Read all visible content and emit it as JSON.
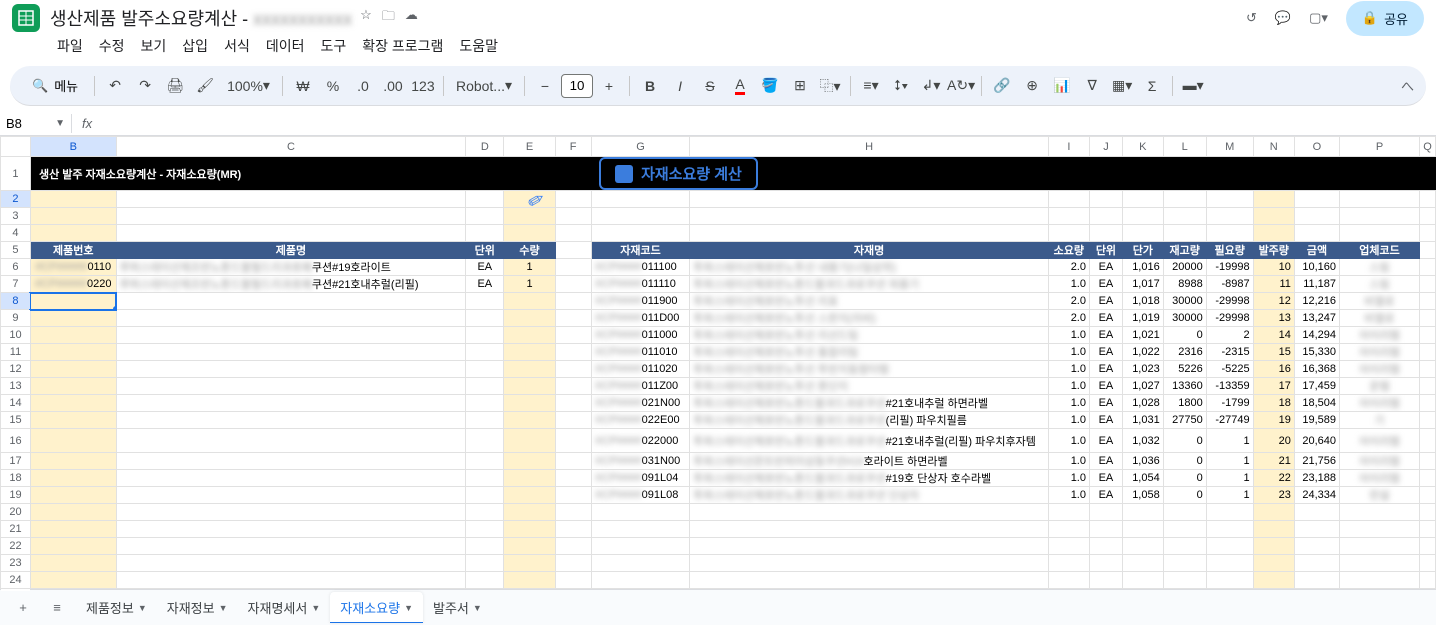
{
  "doc": {
    "title": "생산제품 발주소요량계산 - ",
    "title_suffix": "xxxxxxxxxxx"
  },
  "menus": [
    "파일",
    "수정",
    "보기",
    "삽입",
    "서식",
    "데이터",
    "도구",
    "확장 프로그램",
    "도움말"
  ],
  "toolbar": {
    "search_label": "메뉴",
    "zoom": "100%",
    "currency": "₩",
    "font": "Robot...",
    "font_size": "10"
  },
  "share_label": "공유",
  "namebox": "B8",
  "col_headers": [
    "",
    "B",
    "C",
    "D",
    "E",
    "F",
    "G",
    "H",
    "I",
    "J",
    "K",
    "L",
    "M",
    "N",
    "O",
    "P",
    "Q"
  ],
  "banner_title": "생산 발주 자재소요량계산 - 자재소요량(MR)",
  "calc_button": "자재소요량 계산",
  "left_headers": {
    "b": "제품번호",
    "c": "제품명",
    "d": "단위",
    "e": "수량"
  },
  "right_headers": {
    "g": "자재코드",
    "h": "자재명",
    "i": "소요량",
    "j": "단위",
    "k": "단가",
    "l": "재고량",
    "m": "필요량",
    "n": "발주량",
    "o": "금액",
    "p": "업체코드"
  },
  "left_rows": [
    {
      "b_pre": "#CP#####",
      "b_suf": "0110",
      "c_pre": "루퍼스테이선제조반노톤드팔필드리과호패",
      "c_suf": "쿠션#19호라이트",
      "d": "EA",
      "e": "1"
    },
    {
      "b_pre": "#CP#####",
      "b_suf": "0220",
      "c_pre": "루퍼스테이선제조반노톤드팔필드리과호패",
      "c_suf": "쿠션#21호내추럴(리필)",
      "d": "EA",
      "e": "1"
    }
  ],
  "right_rows": [
    {
      "g_pre": "XCP####",
      "g_suf": "011100",
      "h_pre": "투파스테이선체호반노투선 내용기(나일상위)",
      "h_suf": "",
      "i": "2.0",
      "j": "EA",
      "k": "1,016",
      "l": "20000",
      "m": "-19998",
      "n": "10",
      "o": "10,160",
      "p_pre": "스림",
      "p_suf": ""
    },
    {
      "g_pre": "XCP####",
      "g_suf": "011110",
      "h_pre": "투파스테이선체호반노톤드팔과드과로쿠션 외용기",
      "h_suf": "",
      "i": "1.0",
      "j": "EA",
      "k": "1,017",
      "l": "8988",
      "m": "-8987",
      "n": "11",
      "o": "11,187",
      "p_pre": "스림",
      "p_suf": ""
    },
    {
      "g_pre": "XCP####",
      "g_suf": "011900",
      "h_pre": "투파스테이선체호반노투선 리표",
      "h_suf": "",
      "i": "2.0",
      "j": "EA",
      "k": "1,018",
      "l": "30000",
      "m": "-29998",
      "n": "12",
      "o": "12,216",
      "p_pre": "비열로",
      "p_suf": ""
    },
    {
      "g_pre": "XCP####",
      "g_suf": "011D00",
      "h_pre": "투파스테이선체호반노투선 스판지(자비)",
      "h_suf": "",
      "i": "2.0",
      "j": "EA",
      "k": "1,019",
      "l": "30000",
      "m": "-29998",
      "n": "13",
      "o": "13,247",
      "p_pre": "비열로",
      "p_suf": ""
    },
    {
      "g_pre": "XCP####",
      "g_suf": "011000",
      "h_pre": "투파스테이선체호반노투선 리선드팀",
      "h_suf": "",
      "i": "1.0",
      "j": "EA",
      "k": "1,021",
      "l": "0",
      "m": "2",
      "n": "14",
      "o": "14,294",
      "p_pre": "아이리템",
      "p_suf": ""
    },
    {
      "g_pre": "XCP####",
      "g_suf": "011010",
      "h_pre": "투파스테이선체호반노투선 통합리팀",
      "h_suf": "",
      "i": "1.0",
      "j": "EA",
      "k": "1,022",
      "l": "2316",
      "m": "-2315",
      "n": "15",
      "o": "15,330",
      "p_pre": "아이리템",
      "p_suf": ""
    },
    {
      "g_pre": "XCP####",
      "g_suf": "011020",
      "h_pre": "투파스테이선체호반노투선 투반지동함타템",
      "h_suf": "",
      "i": "1.0",
      "j": "EA",
      "k": "1,023",
      "l": "5226",
      "m": "-5225",
      "n": "16",
      "o": "16,368",
      "p_pre": "아이리템",
      "p_suf": ""
    },
    {
      "g_pre": "XCP####",
      "g_suf": "011Z00",
      "h_pre": "투파스테이선체호반노투선 톤단지",
      "h_suf": "",
      "i": "1.0",
      "j": "EA",
      "k": "1,027",
      "l": "13360",
      "m": "-13359",
      "n": "17",
      "o": "17,459",
      "p_pre": "운템",
      "p_suf": ""
    },
    {
      "g_pre": "XCP####",
      "g_suf": "021N00",
      "h_pre": "투파스테이선체호반노톤드팔과드과로쿠션",
      "h_suf": "#21호내추럴 하면라벨",
      "i": "1.0",
      "j": "EA",
      "k": "1,028",
      "l": "1800",
      "m": "-1799",
      "n": "18",
      "o": "18,504",
      "p_pre": "아이리템",
      "p_suf": ""
    },
    {
      "g_pre": "XCP####",
      "g_suf": "022E00",
      "h_pre": "투파스테이선체호반노톤드팔과드과로쿠션",
      "h_suf": "(리필) 파우치필름",
      "i": "1.0",
      "j": "EA",
      "k": "1,031",
      "l": "27750",
      "m": "-27749",
      "n": "19",
      "o": "19,589",
      "p_pre": "기",
      "p_suf": ""
    },
    {
      "g_pre": "XCP####",
      "g_suf": "022000",
      "h_pre": "투파스테이선체호반노톤드팔과드과로쿠션",
      "h_suf": "#21호내추럴(리필) 파우치후자템",
      "i": "1.0",
      "j": "EA",
      "k": "1,032",
      "l": "0",
      "m": "1",
      "n": "20",
      "o": "20,640",
      "p_pre": "아이리템",
      "p_suf": ""
    },
    {
      "g_pre": "XCP####",
      "g_suf": "031N00",
      "h_pre": "투파스테이선몬트반피미상동쿠션#19",
      "h_suf": "호라이트 하면라벨",
      "i": "1.0",
      "j": "EA",
      "k": "1,036",
      "l": "0",
      "m": "1",
      "n": "21",
      "o": "21,756",
      "p_pre": "아이리템",
      "p_suf": ""
    },
    {
      "g_pre": "XCP####",
      "g_suf": "091L04",
      "h_pre": "투파스테이선체호반노톤드팔과드과로쿠션",
      "h_suf": "#19호 단상자 호수라벨",
      "i": "1.0",
      "j": "EA",
      "k": "1,054",
      "l": "0",
      "m": "1",
      "n": "22",
      "o": "23,188",
      "p_pre": "아이리템",
      "p_suf": ""
    },
    {
      "g_pre": "XCP####",
      "g_suf": "091L08",
      "h_pre": "투파스테이선체호반노톤드팔과드과로쿠션 단상자",
      "h_suf": "",
      "i": "1.0",
      "j": "EA",
      "k": "1,058",
      "l": "0",
      "m": "1",
      "n": "23",
      "o": "24,334",
      "p_pre": "런설",
      "p_suf": ""
    }
  ],
  "sheet_tabs": [
    {
      "label": "제품정보",
      "active": false
    },
    {
      "label": "자재정보",
      "active": false
    },
    {
      "label": "자재명세서",
      "active": false
    },
    {
      "label": "자재소요량",
      "active": true
    },
    {
      "label": "발주서",
      "active": false
    }
  ]
}
